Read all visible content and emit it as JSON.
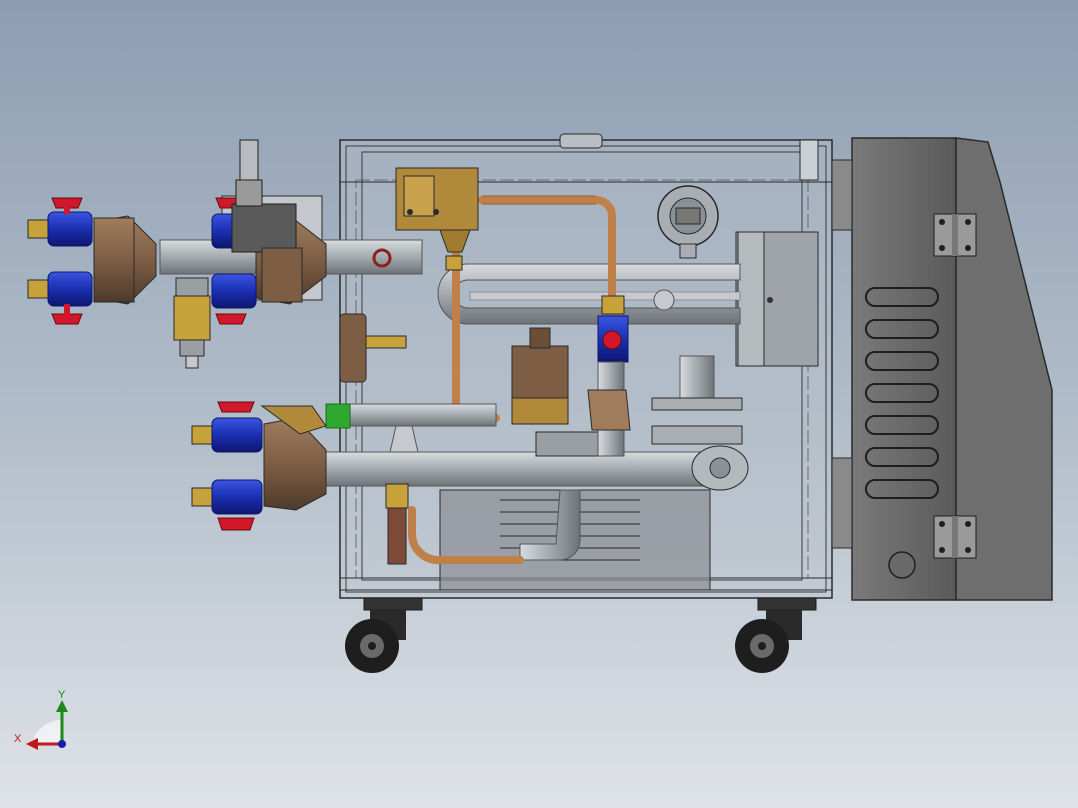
{
  "viewport": {
    "background_top": "#8d9db2",
    "background_bottom": "#dfe3e8"
  },
  "colors": {
    "frame": "#2a2a2a",
    "glass": "#c9d0d6",
    "pipe": "#a9aeb4",
    "copper": "#c0804a",
    "brass": "#b08a3a",
    "manifold": "#7d5e45",
    "valve_blue": "#1b2fb0",
    "valve_handle_red": "#d0182a",
    "fitting_brass": "#c7a23a",
    "green_fitting": "#2fa82f",
    "electrical_box": "#6b6b6b",
    "wheel": "#1e1e1e"
  },
  "triad": {
    "x_label": "X",
    "y_label": "Y",
    "x_color": "#c01818",
    "y_color": "#1a8a1a",
    "z_color": "#1a1ab0"
  }
}
